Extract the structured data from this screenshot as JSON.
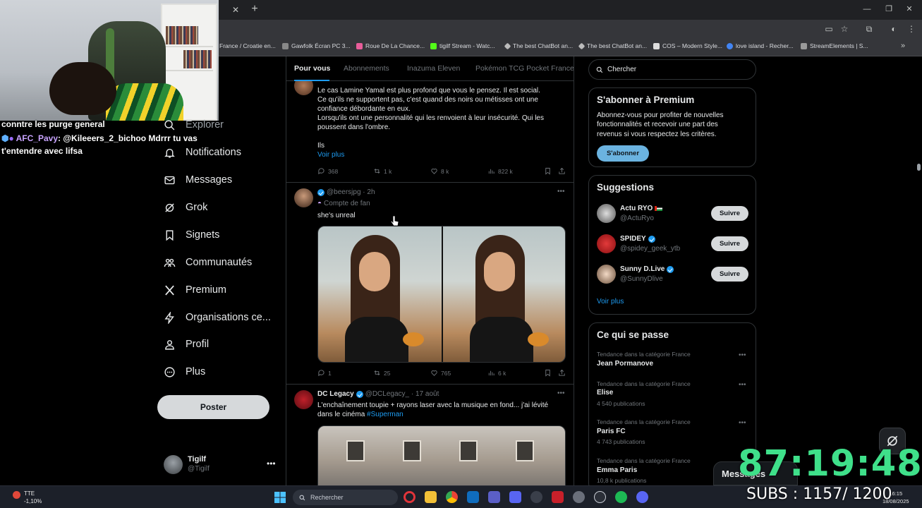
{
  "browser": {
    "bookmarks": [
      {
        "label": "France / Croatie en...",
        "color": "#444"
      },
      {
        "label": "Gawfolk Écran PC 3...",
        "color": "#888"
      },
      {
        "label": "Roue De La Chance...",
        "color": "#e85d9a"
      },
      {
        "label": "tigilf Stream - Watc...",
        "color": "#53fc18"
      },
      {
        "label": "The best ChatBot an...",
        "color": "#bbb"
      },
      {
        "label": "The best ChatBot an...",
        "color": "#bbb"
      },
      {
        "label": "COS – Modern Style...",
        "color": "#ddd"
      },
      {
        "label": "love island - Recher...",
        "color": "#4285f4"
      },
      {
        "label": "StreamElements | S...",
        "color": "#9a9a9a"
      }
    ]
  },
  "stream_chat": {
    "line1": "conntre les purge general",
    "user": "AFC_Pavy",
    "message": ": @Kileeers_2_bichoo Mdrrr tu vas",
    "message2": "t'entendre avec lifsa"
  },
  "nav": {
    "items": [
      {
        "label": "Explorer",
        "icon": "search-icon"
      },
      {
        "label": "Notifications",
        "icon": "bell-icon"
      },
      {
        "label": "Messages",
        "icon": "mail-icon"
      },
      {
        "label": "Grok",
        "icon": "grok-icon"
      },
      {
        "label": "Signets",
        "icon": "bookmark-icon"
      },
      {
        "label": "Communautés",
        "icon": "people-icon"
      },
      {
        "label": "Premium",
        "icon": "x-logo-icon"
      },
      {
        "label": "Organisations ce...",
        "icon": "lightning-icon"
      },
      {
        "label": "Profil",
        "icon": "person-icon"
      },
      {
        "label": "Plus",
        "icon": "more-circle-icon"
      }
    ],
    "post_button": "Poster",
    "profile_name": "Tigilf",
    "profile_handle": "@Tigilf"
  },
  "feed": {
    "tabs": [
      "Pour vous",
      "Abonnements",
      "Inazuma Eleven",
      "Pokémon TCG Pocket France"
    ],
    "tweet1": {
      "lines": [
        "Le cas Lamine Yamal est plus profond que vous le pensez. Il est social.",
        "Ce qu'ils ne supportent pas, c'est quand des noirs ou métisses ont une",
        "confiance débordante en eux.",
        "Lorsqu'ils ont une personnalité qui les renvoient à leur insécurité. Qui les",
        "poussent dans l'ombre.",
        "Ils"
      ],
      "see_more": "Voir plus",
      "replies": "368",
      "reposts": "1 k",
      "likes": "8 k",
      "views": "822 k"
    },
    "tweet2": {
      "handle": "@beersjpg · 2h",
      "badge": "Compte de fan",
      "text": "she's unreal",
      "replies": "1",
      "reposts": "25",
      "likes": "765",
      "views": "6 k"
    },
    "tweet3": {
      "name": "DC Legacy",
      "handle": "@DCLegacy_ · 17 août",
      "line1": "L'enchaînement toupie + rayons laser avec la musique en fond... j'ai lévité",
      "line2": "dans le cinéma ",
      "hashtag": "#Superman"
    }
  },
  "sidebar": {
    "search_placeholder": "Chercher",
    "premium": {
      "title": "S'abonner à Premium",
      "lines": [
        "Abonnez-vous pour profiter de nouvelles",
        "fonctionnalités et recevoir une part des",
        "revenus si vous respectez les critères."
      ],
      "button": "S'abonner"
    },
    "suggestions": {
      "title": "Suggestions",
      "items": [
        {
          "name": "Actu RYO",
          "handle": "@ActuRyo",
          "verified": false
        },
        {
          "name": "SPIDEY",
          "handle": "@spidey_geek_ytb",
          "verified": true
        },
        {
          "name": "Sunny D.Live",
          "handle": "@SunnyDlive",
          "verified": true
        }
      ],
      "follow_label": "Suivre",
      "see_more": "Voir plus"
    },
    "trends": {
      "title": "Ce qui se passe",
      "items": [
        {
          "category": "Tendance dans la catégorie France",
          "name": "Jean Pormanove",
          "count": ""
        },
        {
          "category": "Tendance dans la catégorie France",
          "name": "Elise",
          "count": "4 540 publications"
        },
        {
          "category": "Tendance dans la catégorie France",
          "name": "Paris FC",
          "count": "4 743 publications"
        },
        {
          "category": "Tendance dans la catégorie France",
          "name": "Emma Paris",
          "count": "10,8 k publications"
        }
      ]
    }
  },
  "overlay": {
    "messages_tab": "Messages",
    "timer": "87:19:48",
    "subs": "SUBS : 1157/ 1200"
  },
  "taskbar": {
    "stock_name": "TTE",
    "stock_change": "-1,10%",
    "search": "Rechercher",
    "time": "16:15",
    "date": "18/08/2025"
  }
}
